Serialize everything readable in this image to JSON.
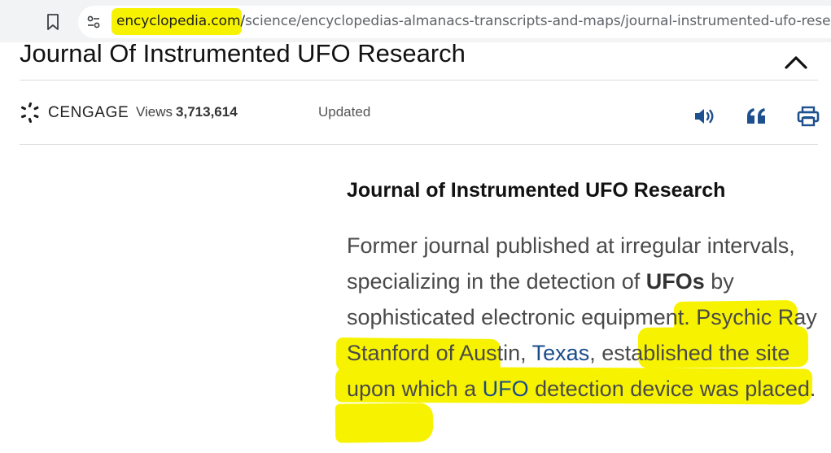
{
  "browser": {
    "url_domain": "encyclopedia.com/",
    "url_path": "science/encyclopedias-almanacs-transcripts-and-maps/journal-instrumented-ufo-research"
  },
  "article": {
    "title": "Journal Of Instrumented UFO Research",
    "publisher": "CENGAGE",
    "views_label": "Views",
    "views_count": "3,713,614",
    "updated_label": "Updated"
  },
  "entry": {
    "heading": "Journal of Instrumented UFO Research",
    "text_1": "Former journal published at irregular intervals, specializing in the detection of ",
    "bold_1": "UFOs",
    "text_2": " by sophisticated electronic equipment. Psychic Ray Stanford of Austin, ",
    "link_1": "Texas",
    "text_3": ", established the site upon which a ",
    "link_2": "UFO",
    "text_4": " detection device was placed."
  },
  "icons": {
    "bookmark": "bookmark-icon",
    "site_info": "site-info-icon",
    "collapse": "chevron-up-icon",
    "audio": "speaker-icon",
    "cite": "quote-icon",
    "print": "printer-icon",
    "logo": "cengage-logo-icon"
  },
  "colors": {
    "highlight": "#f7f300",
    "link": "#1a4c8a",
    "tool_icon": "#1e4f8f",
    "browser_bar": "#f1f3f4"
  }
}
